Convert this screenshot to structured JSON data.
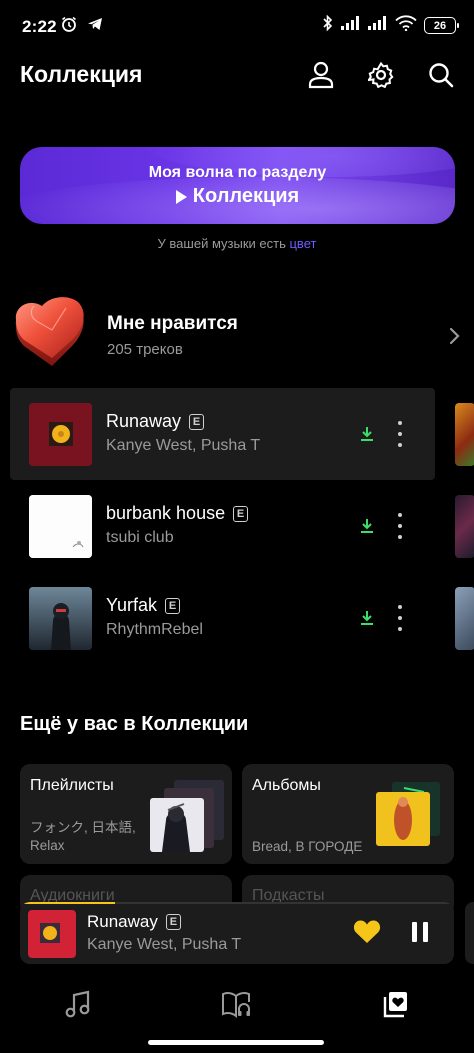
{
  "status_bar": {
    "time": "2:22",
    "battery": "26",
    "icons": [
      "alarm-icon",
      "telegram-icon",
      "bluetooth-icon",
      "signal-icon",
      "signal-icon",
      "wifi-icon",
      "battery-icon"
    ]
  },
  "header": {
    "title": "Коллекция",
    "icons": [
      "profile-icon",
      "settings-icon",
      "search-icon"
    ]
  },
  "wave": {
    "subtitle": "Моя волна по разделу",
    "title": "Коллекция",
    "note_prefix": "У вашей музыки есть",
    "note_link": "цвет"
  },
  "liked": {
    "title": "Мне нравится",
    "count": "205 треков"
  },
  "tracks": [
    {
      "title": "Runaway",
      "artist": "Kanye West, Pusha T",
      "explicit": "E",
      "active": true
    },
    {
      "title": "burbank house",
      "artist": "tsubi club",
      "explicit": "E",
      "active": false
    },
    {
      "title": "Yurfak",
      "artist": "RhythmRebel",
      "explicit": "E",
      "active": false
    }
  ],
  "more_section": {
    "title": "Ещё у вас в Коллекции",
    "cards": [
      {
        "title": "Плейлисты",
        "desc": "フォンク, 日本語, Relax"
      },
      {
        "title": "Альбомы",
        "desc": "Bread, В ГОРОДЕ"
      }
    ],
    "partial_cards": [
      {
        "title": "Аудиокниги"
      },
      {
        "title": "Подкасты"
      }
    ]
  },
  "mini_player": {
    "title": "Runaway",
    "artist": "Kanye West, Pusha T",
    "explicit": "E",
    "progress": 0.22,
    "accent": "#f5c518"
  },
  "bottom_nav": {
    "items": [
      "music-note-icon",
      "book-headphones-icon",
      "collection-heart-icon"
    ],
    "active_index": 2
  },
  "colors": {
    "background": "#000000",
    "card": "#1c1c1c",
    "wave_gradient": [
      "#5b2ad6",
      "#7b4af0"
    ],
    "link": "#6d5cff",
    "download": "#3ddc6b",
    "accent": "#f5c518"
  }
}
